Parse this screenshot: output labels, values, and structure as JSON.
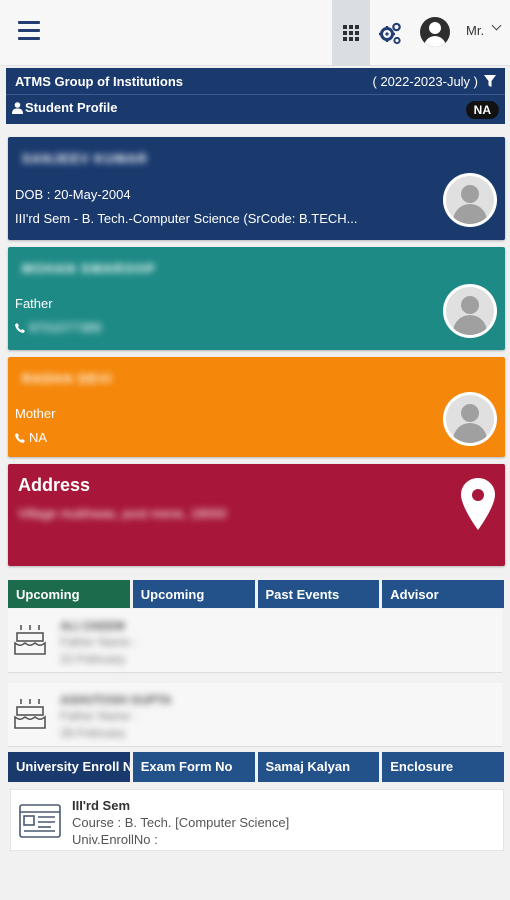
{
  "topbar": {
    "menu_icon": "hamburger-icon",
    "apps_icon": "grid-icon",
    "settings_icon": "gears-icon",
    "user_icon": "user-circle-icon",
    "user_name": "Mr.",
    "caret_icon": "chevron-down-icon"
  },
  "header": {
    "institution": "ATMS Group of Institutions",
    "session": "( 2022-2023-July )",
    "filter_icon": "filter-icon",
    "profile_icon": "user-icon",
    "profile_label": "Student Profile",
    "badge": "NA"
  },
  "student": {
    "name": "SANJEEV KUMAR",
    "dob": "DOB : 20-May-2004",
    "course": "III'rd Sem - B. Tech.-Computer Science (SrCode: B.TECH..."
  },
  "father": {
    "name": "MOHAN SWAROOP",
    "relation": "Father",
    "phone": "9701077389",
    "phone_icon": "phone-icon"
  },
  "mother": {
    "name": "RADHA DEVI",
    "relation": "Mother",
    "phone": "NA",
    "phone_icon": "phone-icon"
  },
  "address": {
    "title": "Address",
    "value": "Village mukhwas, post mene, 18000",
    "icon": "map-marker-icon"
  },
  "tabs1": [
    "Upcoming",
    "Upcoming",
    "Past Events",
    "Advisor"
  ],
  "events": [
    {
      "name": "ALI ZAEEM",
      "father": "Father Name :",
      "date": "22-February",
      "icon": "birthday-cake-icon"
    },
    {
      "name": "ASHUTOSH GUPTA",
      "father": "Father Name :",
      "date": "28-February",
      "icon": "birthday-cake-icon"
    }
  ],
  "tabs2": [
    "University Enroll No",
    "Exam Form No",
    "Samaj Kalyan",
    "Enclosure"
  ],
  "enrollment": {
    "icon": "id-card-icon",
    "title": "III'rd Sem",
    "course": "Course : B. Tech. [Computer Science]",
    "enroll": "Univ.EnrollNo :"
  },
  "colors": {
    "navy": "#1a3a6e",
    "teal": "#1e8a86",
    "orange": "#f5870a",
    "crimson": "#a8173a",
    "tab_blue": "#23528a",
    "tab_green": "#1d6b4d"
  }
}
